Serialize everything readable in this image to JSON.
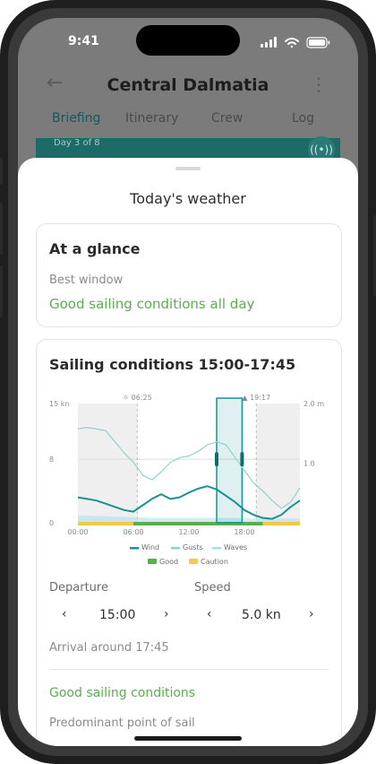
{
  "status": {
    "time": "9:41"
  },
  "header": {
    "title": "Central Dalmatia"
  },
  "tabs": [
    "Briefing",
    "Itinerary",
    "Crew",
    "Log"
  ],
  "trip": {
    "day_label": "Day 3 of 8"
  },
  "sheet": {
    "title": "Today's weather"
  },
  "glance": {
    "title": "At a glance",
    "best_window_label": "Best window",
    "best_window_value": "Good sailing conditions all day"
  },
  "sailing": {
    "title": "Sailing conditions 15:00-17:45",
    "departure_label": "Departure",
    "departure_value": "15:00",
    "speed_label": "Speed",
    "speed_value": "5.0 kn",
    "arrival": "Arrival around 17:45",
    "conditions": "Good sailing conditions",
    "point_of_sail_label": "Predominant point of sail"
  },
  "colors": {
    "accent": "#16938f",
    "good": "#5aae4f",
    "caution": "#f3c94a",
    "gusts": "#8fd3cf",
    "waves": "#a9dcef"
  },
  "chart_data": {
    "type": "line",
    "x": [
      "00:00",
      "01:00",
      "02:00",
      "03:00",
      "04:00",
      "05:00",
      "06:00",
      "07:00",
      "08:00",
      "09:00",
      "10:00",
      "11:00",
      "12:00",
      "13:00",
      "14:00",
      "15:00",
      "16:00",
      "17:00",
      "18:00",
      "19:00",
      "20:00",
      "21:00",
      "22:00",
      "23:00",
      "24:00"
    ],
    "xticks": [
      "00:00",
      "06:00",
      "12:00",
      "18:00"
    ],
    "ylim_left": [
      0,
      15
    ],
    "yticks_left": [
      "15 kn",
      "8",
      "0"
    ],
    "ylim_right": [
      0,
      2.0
    ],
    "yticks_right": [
      "2.0 m",
      "1.0"
    ],
    "sunrise": "06:25",
    "sunset": "19:17",
    "selected_window": [
      "15:00",
      "17:45"
    ],
    "series": [
      {
        "name": "Wind",
        "axis": "left",
        "values": [
          3.2,
          3.0,
          2.8,
          2.4,
          2.0,
          1.6,
          1.4,
          2.2,
          3.0,
          3.6,
          3.0,
          3.2,
          3.8,
          4.3,
          4.6,
          4.2,
          3.4,
          2.6,
          1.6,
          1.0,
          0.6,
          0.5,
          1.0,
          2.0,
          2.8
        ]
      },
      {
        "name": "Gusts",
        "axis": "left",
        "values": [
          11.8,
          12.0,
          11.8,
          11.6,
          10.2,
          8.8,
          7.6,
          6.0,
          5.4,
          6.4,
          7.6,
          8.2,
          8.4,
          9.0,
          9.8,
          10.2,
          9.8,
          8.2,
          6.6,
          5.0,
          4.0,
          2.8,
          1.8,
          2.6,
          4.4
        ]
      },
      {
        "name": "Waves",
        "axis": "right",
        "values": [
          0.12,
          0.12,
          0.11,
          0.11,
          0.1,
          0.1,
          0.09,
          0.09,
          0.08,
          0.08,
          0.08,
          0.08,
          0.08,
          0.08,
          0.08,
          0.08,
          0.08,
          0.08,
          0.07,
          0.07,
          0.07,
          0.07,
          0.07,
          0.07,
          0.07
        ]
      }
    ],
    "conditions_bar": [
      {
        "from": "00:00",
        "to": "06:00",
        "state": "Caution"
      },
      {
        "from": "06:00",
        "to": "20:00",
        "state": "Good"
      },
      {
        "from": "20:00",
        "to": "24:00",
        "state": "Caution"
      }
    ],
    "legend": [
      "Wind",
      "Gusts",
      "Waves",
      "Good",
      "Caution"
    ]
  }
}
